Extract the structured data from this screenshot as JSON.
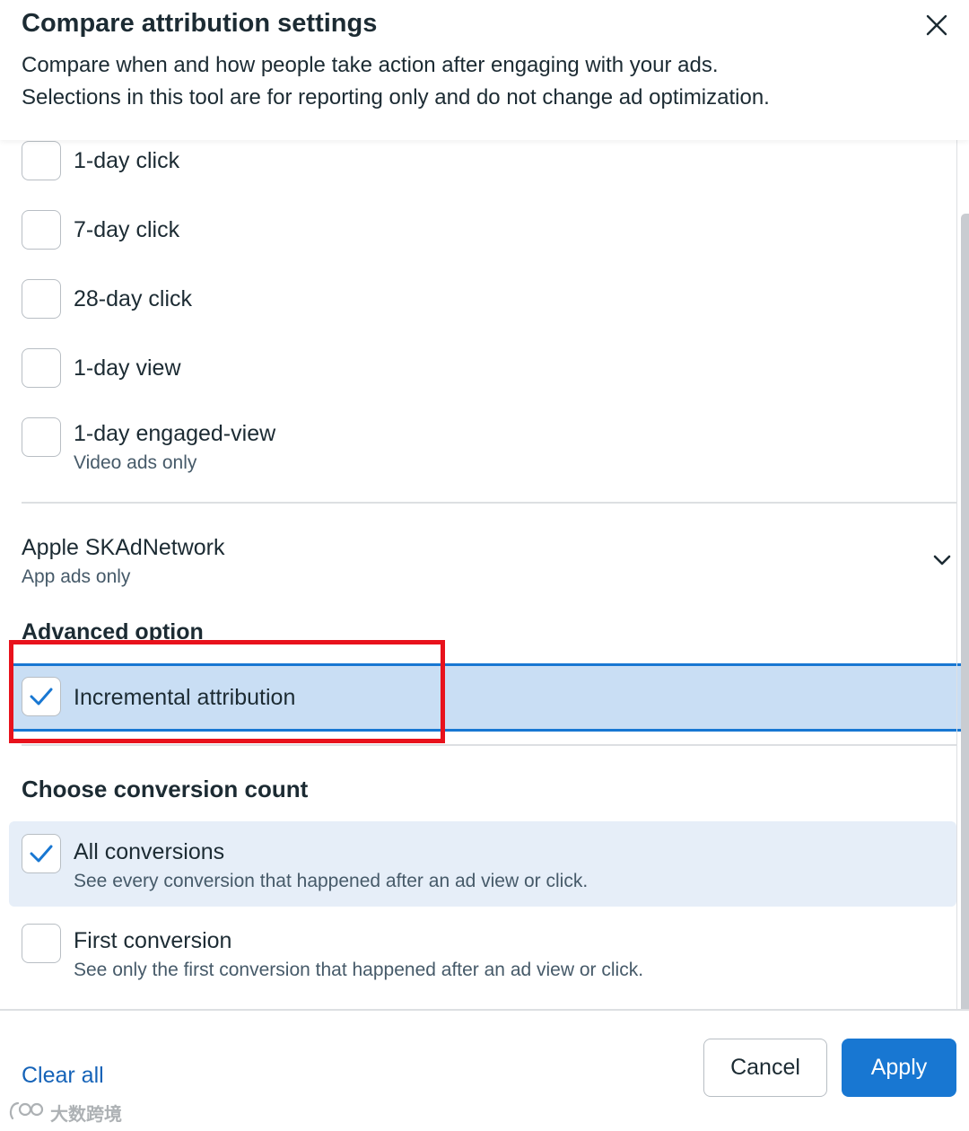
{
  "header": {
    "title": "Compare attribution settings",
    "description_line1": "Compare when and how people take action after engaging with your ads.",
    "description_line2": "Selections in this tool are for reporting only and do not change ad optimization."
  },
  "attribution_windows": [
    {
      "label": "1-day click",
      "checked": false
    },
    {
      "label": "7-day click",
      "checked": false
    },
    {
      "label": "28-day click",
      "checked": false
    },
    {
      "label": "1-day view",
      "checked": false
    },
    {
      "label": "1-day engaged-view",
      "sublabel": "Video ads only",
      "checked": false
    }
  ],
  "skadnetwork": {
    "title": "Apple SKAdNetwork",
    "subtitle": "App ads only",
    "icon": "chevron-down-icon"
  },
  "advanced": {
    "title": "Advanced option",
    "incremental_label": "Incremental attribution",
    "incremental_checked": true
  },
  "conversion_count": {
    "title": "Choose conversion count",
    "options": [
      {
        "label": "All conversions",
        "sublabel": "See every conversion that happened after an ad view or click.",
        "checked": true
      },
      {
        "label": "First conversion",
        "sublabel": "See only the first conversion that happened after an ad view or click.",
        "checked": false
      }
    ]
  },
  "footer": {
    "clear_all": "Clear all",
    "cancel": "Cancel",
    "apply": "Apply"
  },
  "watermark": {
    "text": "大数跨境",
    "icon": "watermark-logo-icon"
  },
  "colors": {
    "accent": "#1877d2",
    "highlight_row": "#c9def4",
    "selected_row": "#e6eef8",
    "annotation_red": "#e8121c",
    "text": "#1c2b33"
  }
}
